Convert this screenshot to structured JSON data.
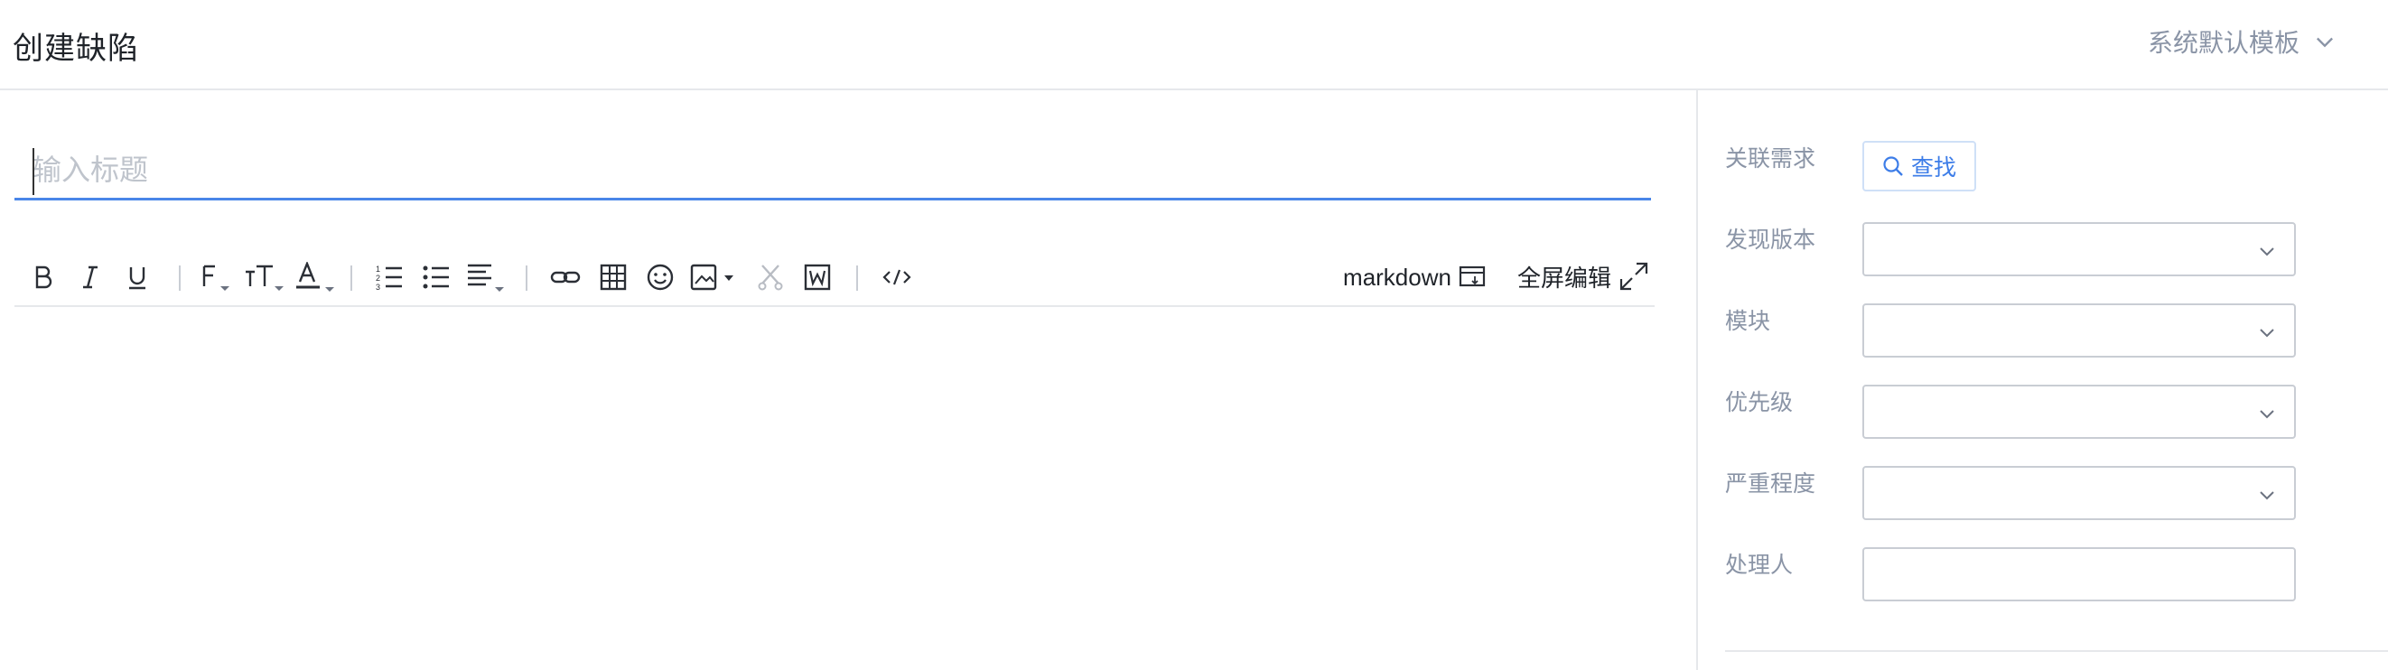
{
  "header": {
    "title": "创建缺陷",
    "template_select": "系统默认模板"
  },
  "editor": {
    "title_placeholder": "输入标题",
    "title_value": "",
    "toolbar": {
      "markdown_label": "markdown",
      "fullscreen_label": "全屏编辑",
      "icons": [
        "bold-icon",
        "italic-icon",
        "underline-icon",
        "font-family-icon",
        "font-size-icon",
        "font-color-icon",
        "ordered-list-icon",
        "unordered-list-icon",
        "align-icon",
        "link-icon",
        "table-icon",
        "emoji-icon",
        "image-icon",
        "clear-format-icon",
        "word-import-icon",
        "code-icon"
      ]
    }
  },
  "sidebar": {
    "related_requirement": {
      "label": "关联需求",
      "button": "查找"
    },
    "found_version": {
      "label": "发现版本",
      "value": ""
    },
    "module": {
      "label": "模块",
      "value": ""
    },
    "priority": {
      "label": "优先级",
      "value": ""
    },
    "severity": {
      "label": "严重程度",
      "value": ""
    },
    "assignee": {
      "label": "处理人",
      "value": ""
    }
  },
  "colors": {
    "accent": "#4a86e8",
    "muted_text": "#8a94a6",
    "border": "#c9cdd4"
  }
}
